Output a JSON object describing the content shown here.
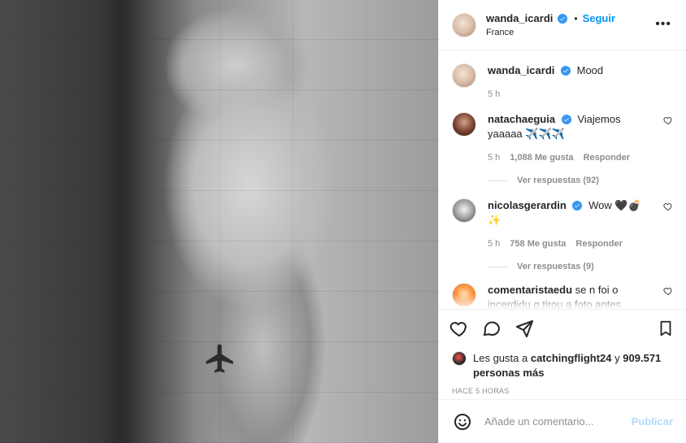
{
  "post": {
    "username": "wanda_icardi",
    "follow_label": "Seguir",
    "location": "France",
    "more_label": "•••",
    "caption": {
      "text": "Mood",
      "time": "5 h"
    }
  },
  "comments": [
    {
      "username": "natachaeguia",
      "text": "Viajemos yaaaaa ✈️✈️✈️",
      "time": "5 h",
      "likes": "1,088 Me gusta",
      "reply_label": "Responder",
      "view_replies": "Ver respuestas (92)"
    },
    {
      "username": "nicolasgerardin",
      "text": "Wow 🖤💣✨",
      "time": "5 h",
      "likes": "758 Me gusta",
      "reply_label": "Responder",
      "view_replies": "Ver respuestas (9)"
    },
    {
      "username": "comentaristaedu",
      "text": "se n foi o incerdidu q tirou a foto antes"
    }
  ],
  "likes_line": {
    "prefix": "Les gusta a",
    "user": "catchingflight24",
    "suffix": "y",
    "count": "909.571 personas más"
  },
  "timestamp": "HACE 5 HORAS",
  "add_comment": {
    "placeholder": "Añade un comentario...",
    "publish_label": "Publicar"
  },
  "colors": {
    "link_blue": "#0095f6",
    "verified_blue": "#3897f0",
    "publish_disabled": "#b3dbff"
  },
  "icons": {
    "like": "heart-icon",
    "comment": "comment-icon",
    "share": "share-icon",
    "save": "bookmark-icon",
    "emoji": "emoji-icon",
    "more": "more-icon"
  }
}
